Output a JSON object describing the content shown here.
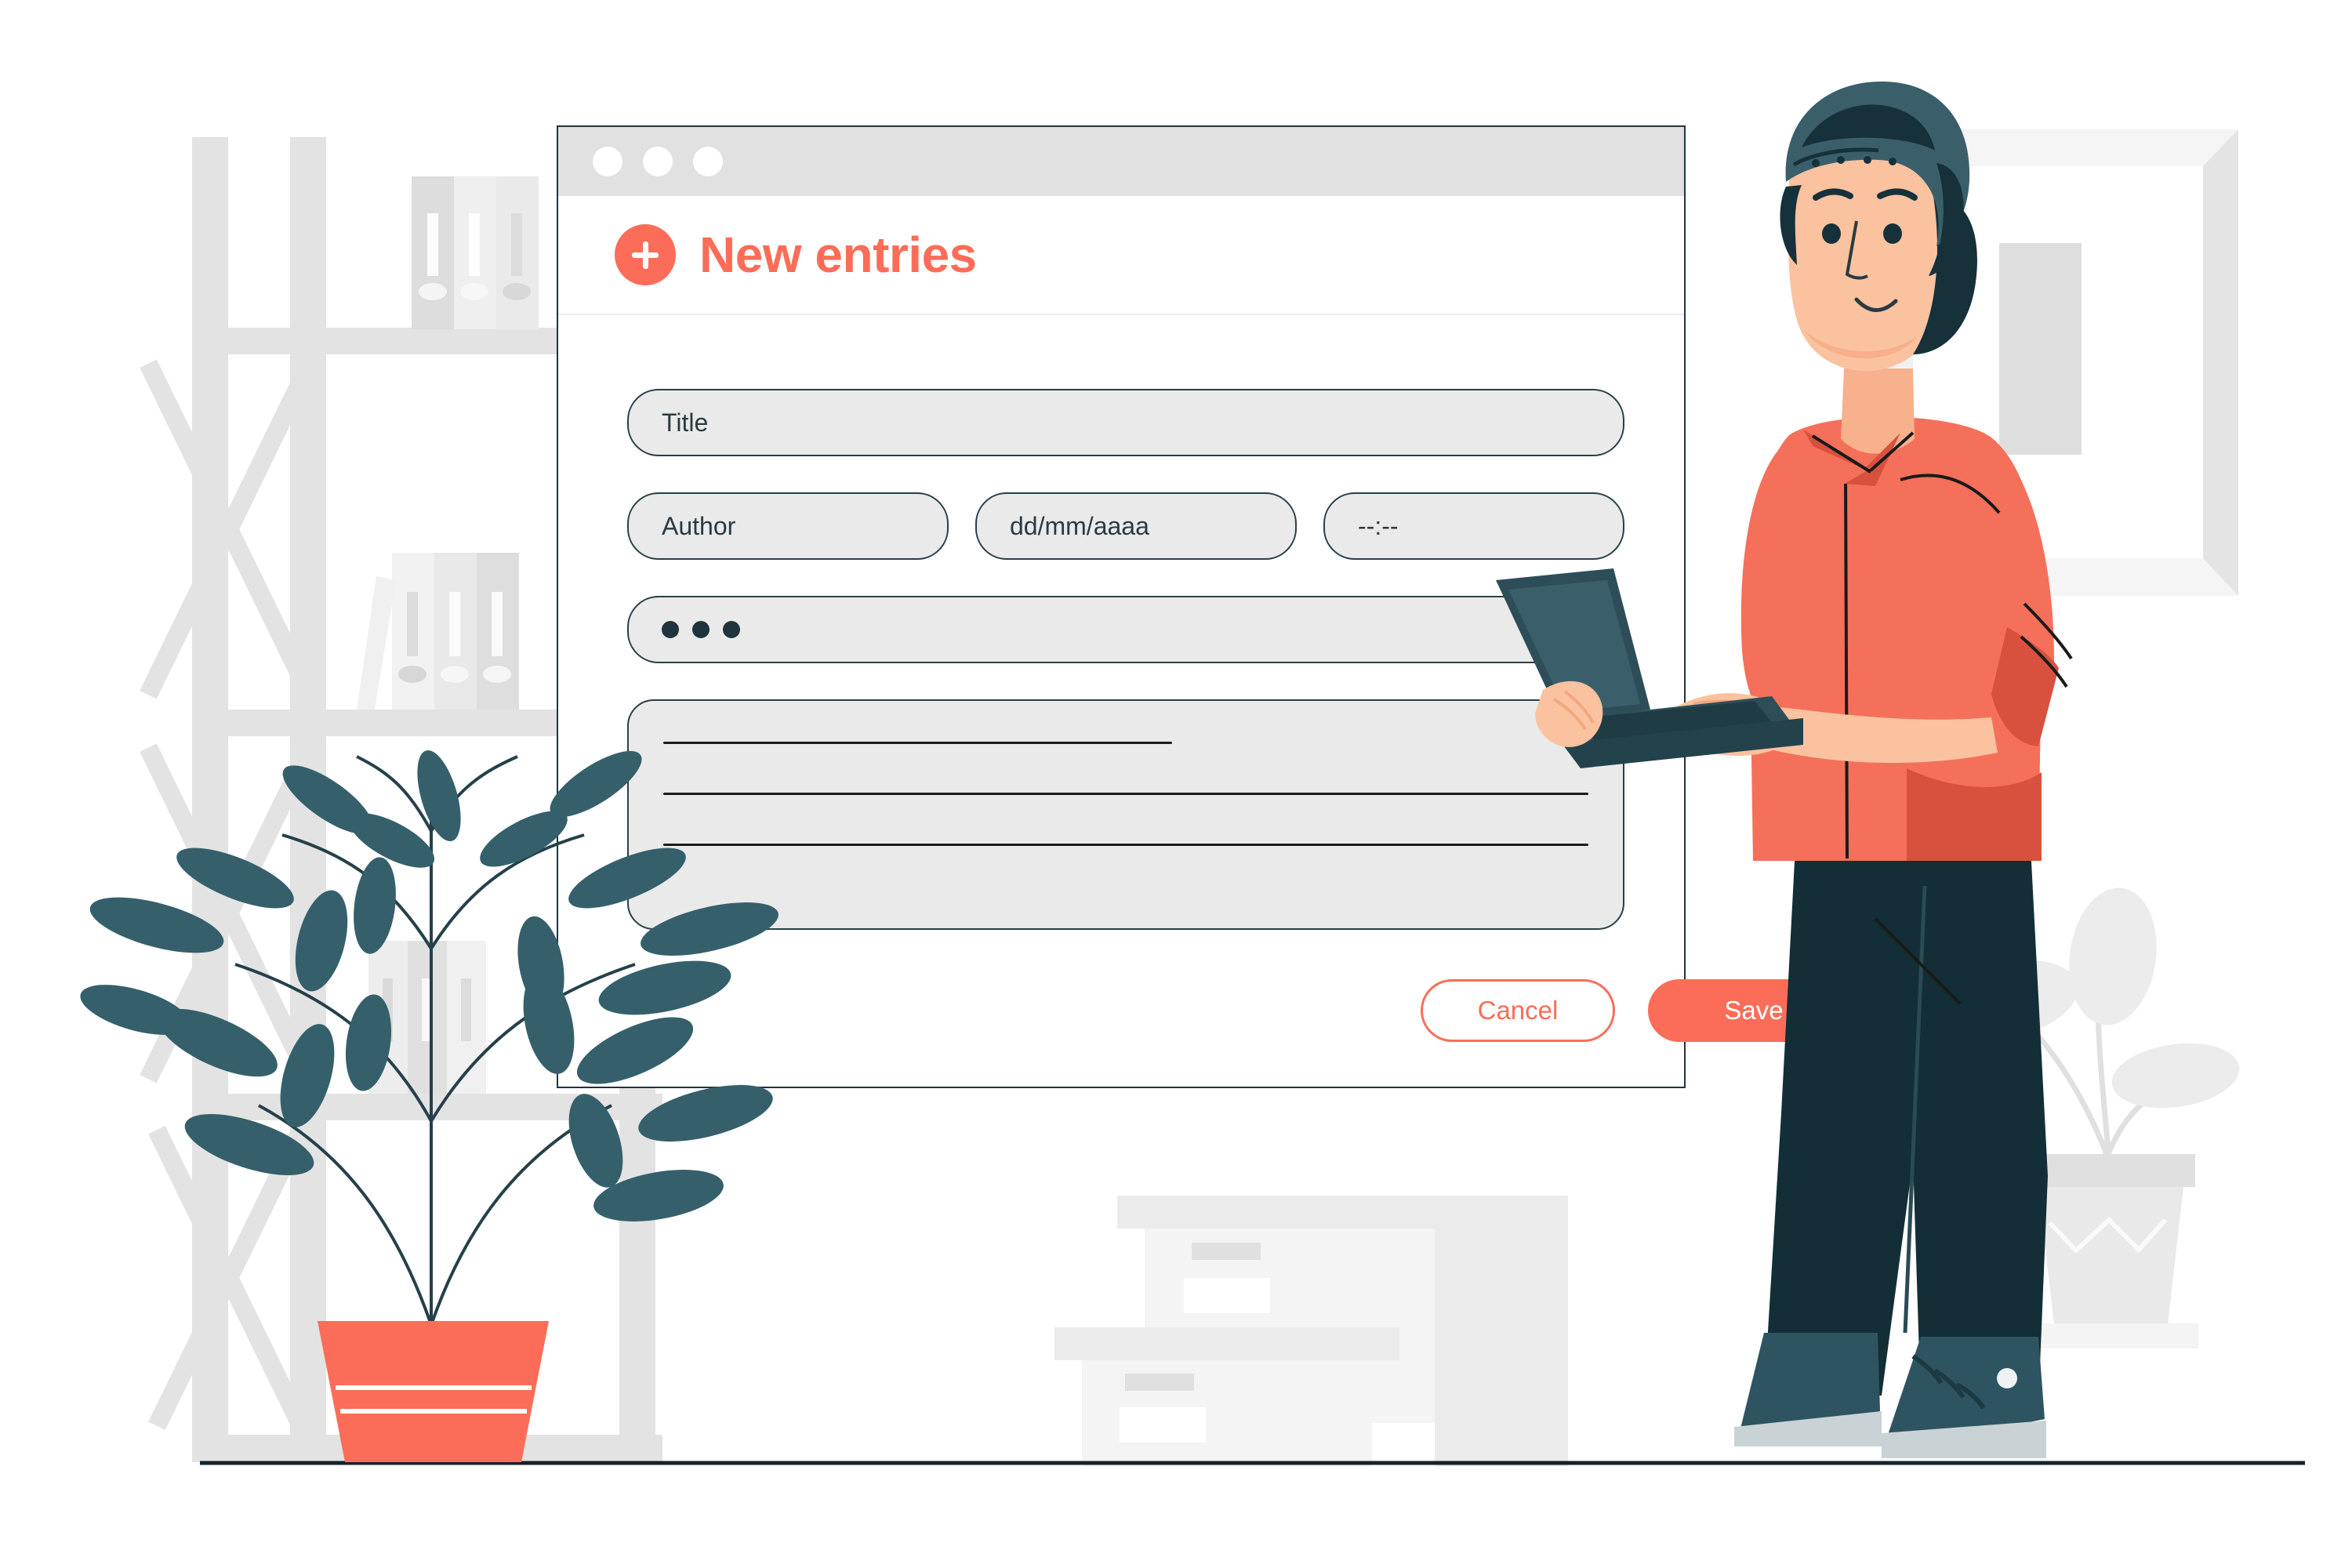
{
  "window": {
    "traffic_dots": [
      "dot-1",
      "dot-2",
      "dot-3"
    ]
  },
  "header": {
    "icon": "plus-icon",
    "title": "New entries"
  },
  "form": {
    "fields": [
      {
        "name": "title",
        "placeholder": "Title",
        "type": "text"
      },
      {
        "name": "author",
        "placeholder": "Author",
        "type": "text"
      },
      {
        "name": "date",
        "placeholder": "dd/mm/aaaa",
        "type": "date"
      },
      {
        "name": "time",
        "placeholder": "--:--",
        "type": "time"
      },
      {
        "name": "password",
        "placeholder": "",
        "type": "password",
        "masked_chars": 3
      },
      {
        "name": "description",
        "placeholder": "",
        "type": "textarea",
        "lines": 3
      }
    ]
  },
  "actions": {
    "cancel_label": "Cancel",
    "save_label": "Save"
  },
  "colors": {
    "accent": "#fb6d58",
    "outline": "#20343d",
    "field_fill": "#eaeaea",
    "titlebar": "#e1e1e1",
    "scenery_gray": "#e3e3e3",
    "foliage": "#35606b",
    "skin": "#fbc2a0",
    "trouser": "#132e36"
  },
  "scene": {
    "items": [
      "bookshelf",
      "binders",
      "potted-plant-foreground",
      "storage-boxes",
      "picture-frame",
      "potted-plant-background",
      "person-with-laptop",
      "floor-line"
    ]
  }
}
